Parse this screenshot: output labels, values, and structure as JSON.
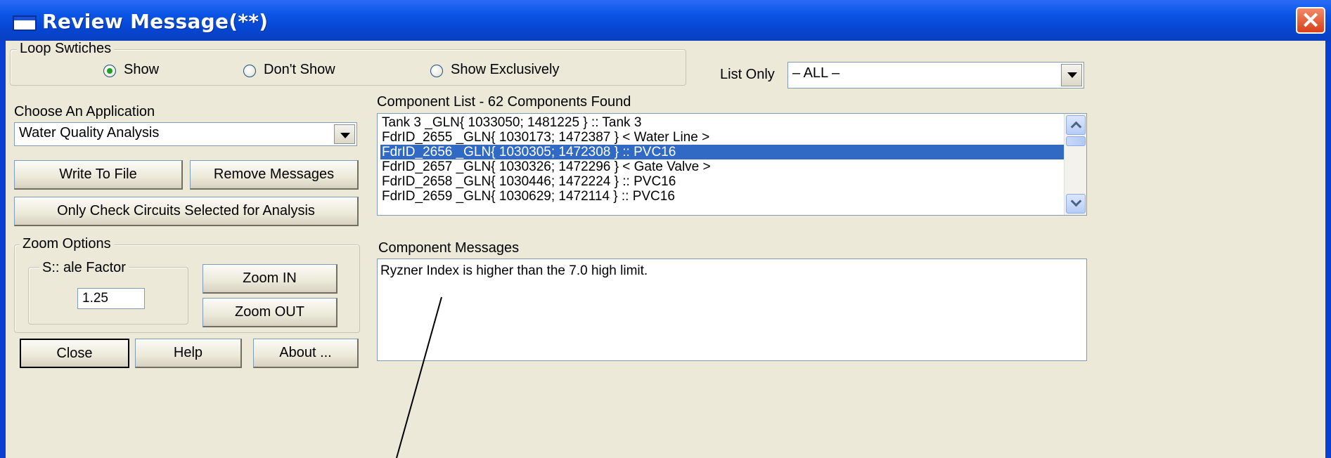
{
  "window": {
    "title": "Review Message(**)",
    "close_symbol": "✕",
    "title_icon": "window-icon",
    "title_bar_color": "#0b55e6",
    "close_color": "#d8401a"
  },
  "loop_switches": {
    "legend": "Loop Swtiches",
    "options": [
      {
        "label": "Show",
        "selected": true
      },
      {
        "label": "Don't Show",
        "selected": false
      },
      {
        "label": "Show Exclusively",
        "selected": false
      }
    ]
  },
  "list_only": {
    "label": "List Only",
    "value": "– ALL –"
  },
  "application": {
    "label": "Choose An Application",
    "value": "Water Quality Analysis"
  },
  "buttons": {
    "write_to_file": "Write To File",
    "remove_messages": "Remove Messages",
    "only_check": "Only Check Circuits Selected for Analysis",
    "zoom_in": "Zoom  IN",
    "zoom_out": "Zoom  OUT",
    "close": "Close",
    "help": "Help",
    "about": "About ..."
  },
  "zoom": {
    "legend": "Zoom Options",
    "scale_legend": "S:: ale Factor",
    "scale_value": "1.25"
  },
  "components": {
    "header": "Component List - 62 Components Found",
    "selected_index": 2,
    "selection_color": "#316ac5",
    "items": [
      "Tank 3 _GLN{ 1033050; 1481225 } :: Tank 3",
      "FdrID_2655 _GLN{ 1030173; 1472387 } < Water Line >",
      "FdrID_2656 _GLN{ 1030305; 1472308 } :: PVC16",
      "FdrID_2657 _GLN{ 1030326; 1472296 } < Gate Valve >",
      "FdrID_2658 _GLN{ 1030446; 1472224 } :: PVC16",
      "FdrID_2659 _GLN{ 1030629; 1472114 } :: PVC16"
    ]
  },
  "messages": {
    "header": "Component Messages",
    "text": "Ryzner Index is higher than the 7.0 high limit."
  }
}
